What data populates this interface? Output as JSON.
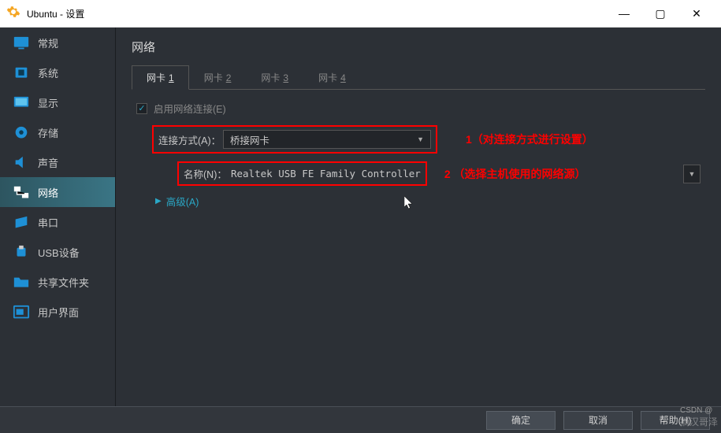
{
  "window": {
    "title": "Ubuntu - 设置",
    "minimize": "—",
    "maximize": "▢",
    "close": "✕"
  },
  "sidebar": {
    "items": [
      {
        "label": "常规"
      },
      {
        "label": "系统"
      },
      {
        "label": "显示"
      },
      {
        "label": "存储"
      },
      {
        "label": "声音"
      },
      {
        "label": "网络"
      },
      {
        "label": "串口"
      },
      {
        "label": "USB设备"
      },
      {
        "label": "共享文件夹"
      },
      {
        "label": "用户界面"
      }
    ],
    "active_index": 5
  },
  "main": {
    "title": "网络",
    "tabs": [
      {
        "label": "网卡",
        "key": "1"
      },
      {
        "label": "网卡",
        "key": "2"
      },
      {
        "label": "网卡",
        "key": "3"
      },
      {
        "label": "网卡",
        "key": "4"
      }
    ],
    "active_tab": 0,
    "enable_checkbox": {
      "checked": true,
      "label": "启用网络连接(E)"
    },
    "connection": {
      "label": "连接方式(A)：",
      "value": "桥接网卡"
    },
    "name": {
      "label": "名称(N)：",
      "value": "Realtek USB FE Family Controller"
    },
    "advanced": "高级(A)"
  },
  "annotations": {
    "a1": "1（对连接方式进行设置）",
    "a2": "2  （选择主机使用的网络源）"
  },
  "footer": {
    "ok": "确定",
    "cancel": "取消",
    "help": "帮助(H)"
  },
  "watermark": "摘汉哥泽"
}
